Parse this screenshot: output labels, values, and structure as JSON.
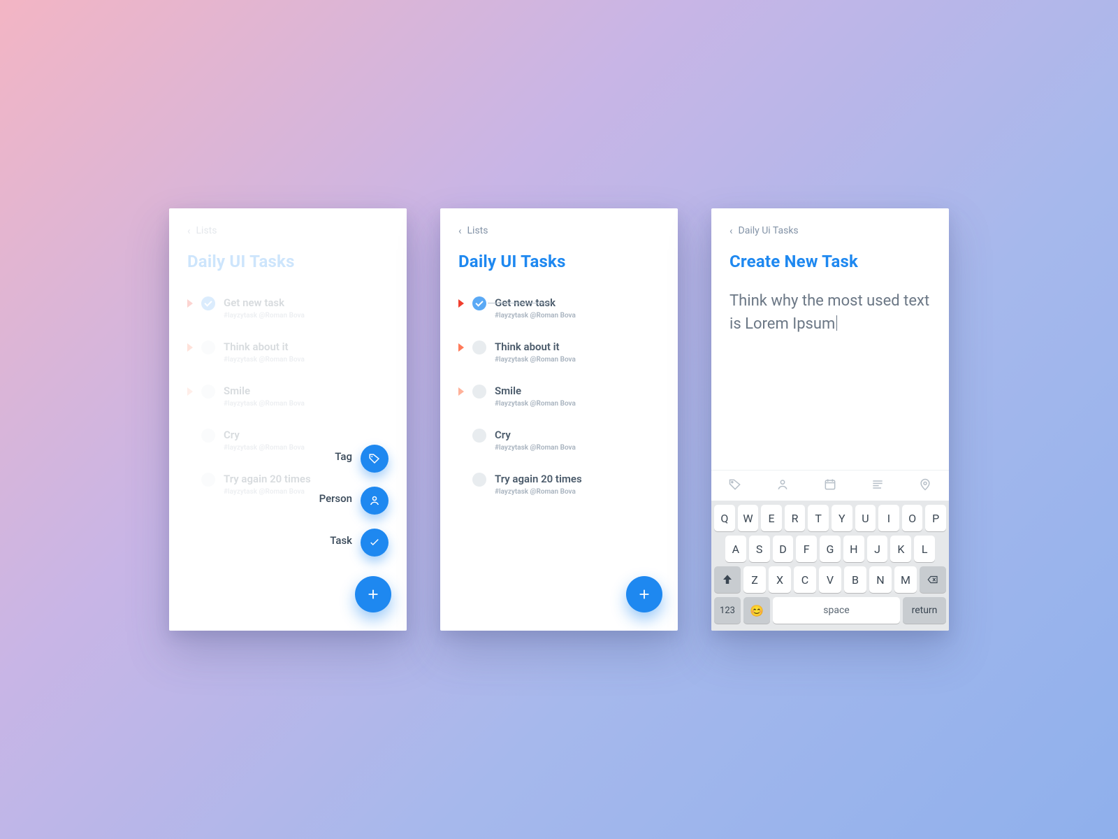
{
  "colors": {
    "accent": "#1e88f0"
  },
  "screen1": {
    "back": "Lists",
    "title": "Daily UI Tasks",
    "tasks": [
      {
        "title": "Get new task",
        "meta": "#layzytask   @Roman Bova",
        "done": true,
        "priority": "red"
      },
      {
        "title": "Think about it",
        "meta": "#layzytask   @Roman Bova",
        "done": false,
        "priority": "or"
      },
      {
        "title": "Smile",
        "meta": "#layzytask   @Roman Bova",
        "done": false,
        "priority": "orl"
      },
      {
        "title": "Cry",
        "meta": "#layzytask   @Roman Bova",
        "done": false,
        "priority": "none"
      },
      {
        "title": "Try again 20 times",
        "meta": "#layzytask   @Roman Bova",
        "done": false,
        "priority": "none"
      }
    ],
    "actions": [
      {
        "label": "Tag",
        "icon": "tag"
      },
      {
        "label": "Person",
        "icon": "person"
      },
      {
        "label": "Task",
        "icon": "check"
      }
    ]
  },
  "screen2": {
    "back": "Lists",
    "title": "Daily UI Tasks",
    "tasks": [
      {
        "title": "Get new task",
        "meta": "#layzytask   @Roman Bova",
        "done": true,
        "priority": "red"
      },
      {
        "title": "Think about it",
        "meta": "#layzytask   @Roman Bova",
        "done": false,
        "priority": "or"
      },
      {
        "title": "Smile",
        "meta": "#layzytask   @Roman Bova",
        "done": false,
        "priority": "orl"
      },
      {
        "title": "Cry",
        "meta": "#layzytask   @Roman Bova",
        "done": false,
        "priority": "none"
      },
      {
        "title": "Try again 20 times",
        "meta": "#layzytask   @Roman Bova",
        "done": false,
        "priority": "none"
      }
    ]
  },
  "screen3": {
    "back": "Daily Ui Tasks",
    "title": "Create New Task",
    "compose_text": "Think why the most used text is Lorem Ipsum",
    "toolbar_icons": [
      "tag",
      "person",
      "calendar",
      "text",
      "location"
    ],
    "keyboard": {
      "row1": [
        "Q",
        "W",
        "E",
        "R",
        "T",
        "Y",
        "U",
        "I",
        "O",
        "P"
      ],
      "row2": [
        "A",
        "S",
        "D",
        "F",
        "G",
        "H",
        "J",
        "K",
        "L"
      ],
      "row3": [
        "Z",
        "X",
        "C",
        "V",
        "B",
        "N",
        "M"
      ],
      "numeric": "123",
      "space": "space",
      "return": "return"
    }
  }
}
